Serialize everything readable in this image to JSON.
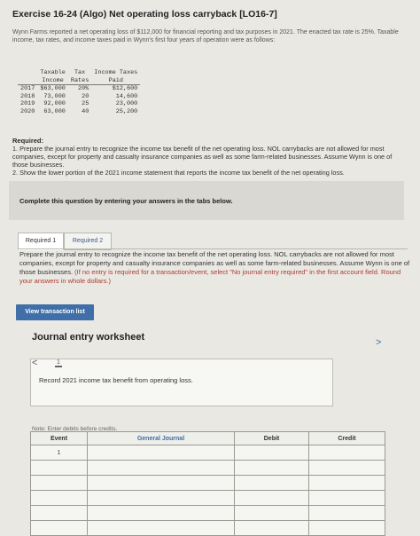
{
  "header": {
    "title": "Exercise 16-24 (Algo) Net operating loss carryback [LO16-7]"
  },
  "intro": "Wynn Farms reported a net operating loss of $112,000 for financial reporting and tax purposes in 2021. The enacted tax rate is 25%. Taxable income, tax rates, and income taxes paid in Wynn's first four years of operation were as follows:",
  "data_table": {
    "headers": {
      "col1_line1": "Taxable",
      "col1_line2": "Income",
      "col2_line1": "Tax",
      "col2_line2": "Rates",
      "col3_line1": "Income Taxes",
      "col3_line2": "Paid"
    },
    "rows": [
      {
        "year": "2017",
        "income": "$63,000",
        "rate": "20%",
        "paid": "$12,600"
      },
      {
        "year": "2018",
        "income": "73,000",
        "rate": "20",
        "paid": "14,600"
      },
      {
        "year": "2019",
        "income": "92,000",
        "rate": "25",
        "paid": "23,000"
      },
      {
        "year": "2020",
        "income": "63,000",
        "rate": "40",
        "paid": "25,200"
      }
    ]
  },
  "required": {
    "heading": "Required:",
    "item1": "1. Prepare the journal entry to recognize the income tax benefit of the net operating loss. NOL carrybacks are not allowed for most companies, except for property and casualty insurance companies as well as some farm-related businesses. Assume Wynn is one of those businesses.",
    "item2": "2. Show the lower portion of the 2021 income statement that reports the income tax benefit of the net operating loss."
  },
  "banner": "Complete this question by entering your answers in the tabs below.",
  "tabs": [
    {
      "label": "Required 1"
    },
    {
      "label": "Required 2"
    }
  ],
  "instructions": {
    "main": "Prepare the journal entry to recognize the income tax benefit of the net operating loss. NOL carrybacks are not allowed for most companies, except for property and casualty insurance companies as well as some farm-related businesses. Assume Wynn is one of those businesses.",
    "red": "(If no entry is required for a transaction/event, select \"No journal entry required\" in the first account field. Round your answers in whole dollars.)"
  },
  "view_button": "View transaction list",
  "worksheet": {
    "title": "Journal entry worksheet",
    "prev": "<",
    "next": ">",
    "entry_number": "1",
    "description": "Record 2021 income tax benefit from operating loss."
  },
  "note": "Note: Enter debits before credits.",
  "journal": {
    "headers": {
      "event": "Event",
      "general_journal": "General Journal",
      "debit": "Debit",
      "credit": "Credit"
    },
    "rows": [
      {
        "event": "1"
      },
      {
        "event": ""
      },
      {
        "event": ""
      },
      {
        "event": ""
      },
      {
        "event": ""
      },
      {
        "event": ""
      }
    ]
  }
}
